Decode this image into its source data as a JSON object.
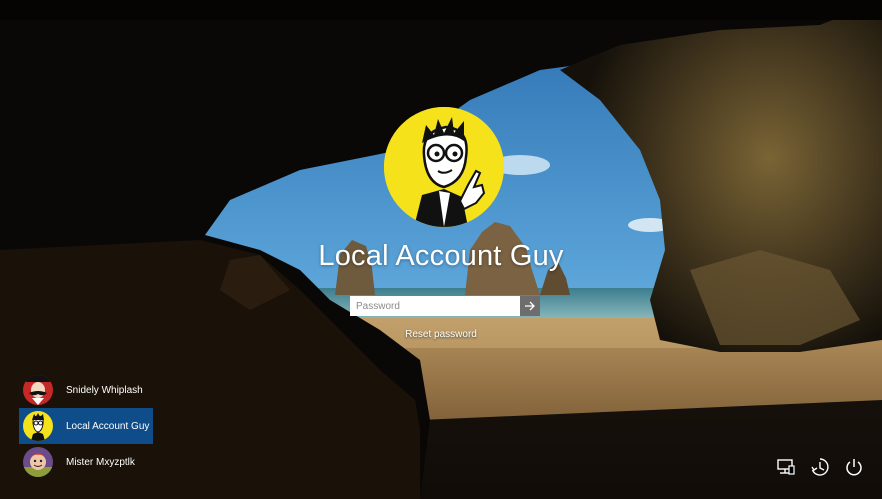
{
  "user": {
    "name": "Local Account Guy"
  },
  "password": {
    "placeholder": "Password",
    "submit_icon": "arrow-right-icon"
  },
  "reset": {
    "label": "Reset password"
  },
  "users_list": [
    {
      "name": "Snidely Whiplash",
      "active": false
    },
    {
      "name": "Local Account Guy",
      "active": true
    },
    {
      "name": "Mister Mxyzptlk",
      "active": false
    }
  ],
  "tray_icons": [
    "network-icon",
    "accessibility-icon",
    "power-icon"
  ],
  "colors": {
    "selection": "#0f4d8a",
    "avatar_yellow": "#f5e21b"
  }
}
